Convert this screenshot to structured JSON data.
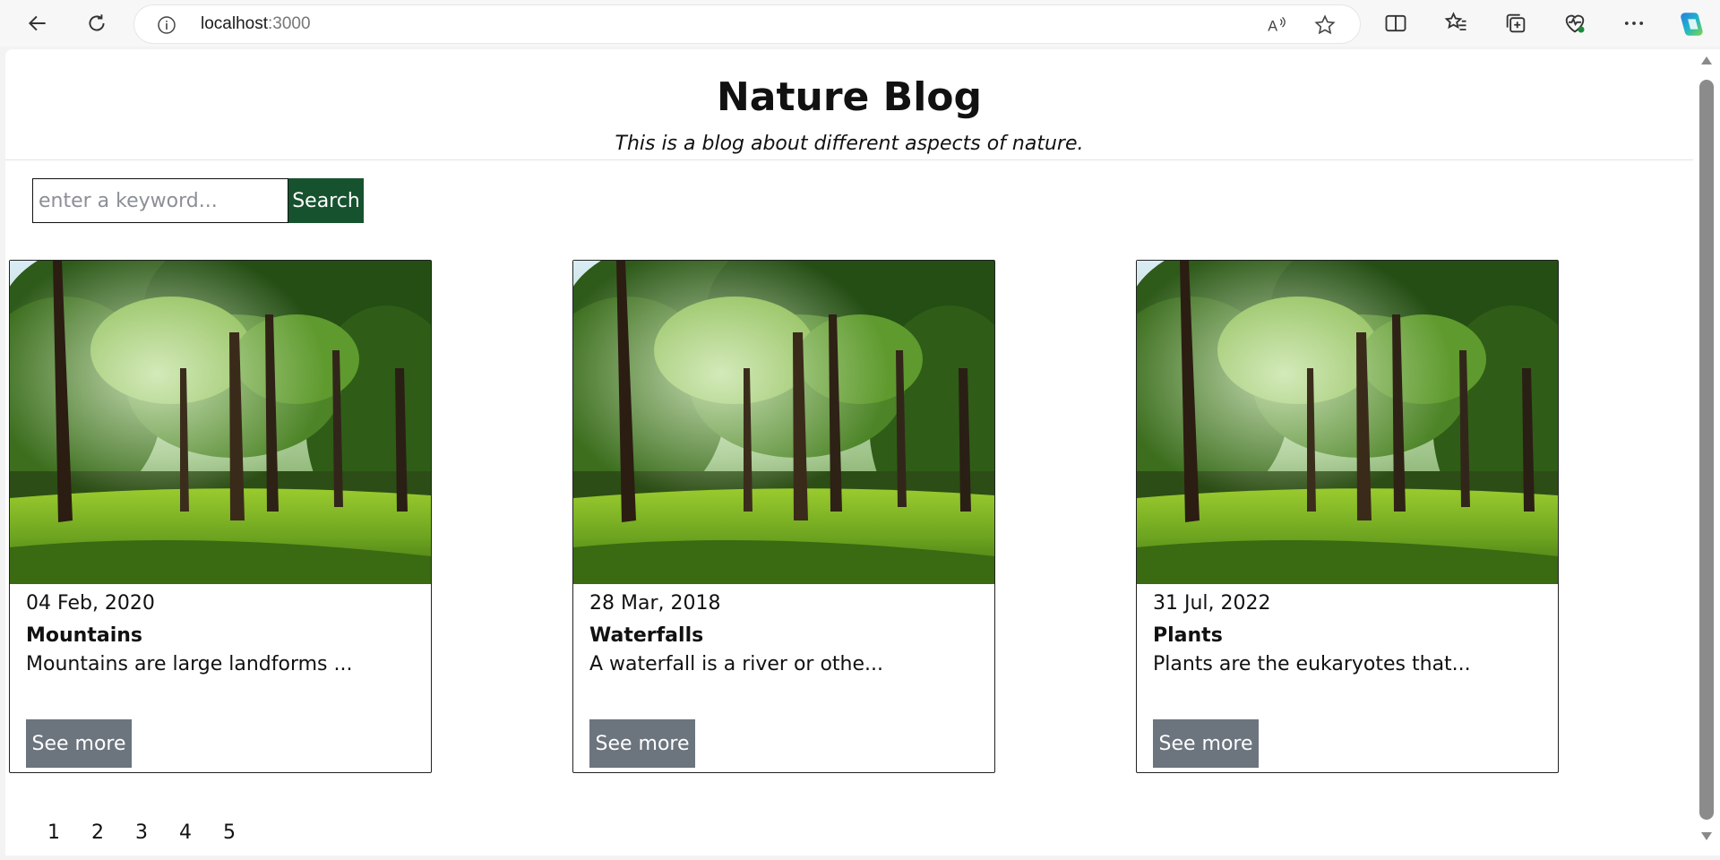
{
  "browser": {
    "url_host": "localhost",
    "url_port": ":3000"
  },
  "header": {
    "title": "Nature Blog",
    "subtitle": "This is a blog about different aspects of nature."
  },
  "search": {
    "placeholder": "enter a keyword...",
    "value": "",
    "button_label": "Search",
    "button_color": "#17522f"
  },
  "cards": [
    {
      "date": "04 Feb, 2020",
      "title": "Mountains",
      "excerpt": "Mountains are large landforms ...",
      "button_label": "See more"
    },
    {
      "date": "28 Mar, 2018",
      "title": "Waterfalls",
      "excerpt": "A waterfall is a river or othe...",
      "button_label": "See more"
    },
    {
      "date": "31 Jul, 2022",
      "title": "Plants",
      "excerpt": "Plants are the eukaryotes that...",
      "button_label": "See more"
    }
  ],
  "pagination": [
    "1",
    "2",
    "3",
    "4",
    "5"
  ],
  "colors": {
    "see_more_button": "#6c747e"
  }
}
